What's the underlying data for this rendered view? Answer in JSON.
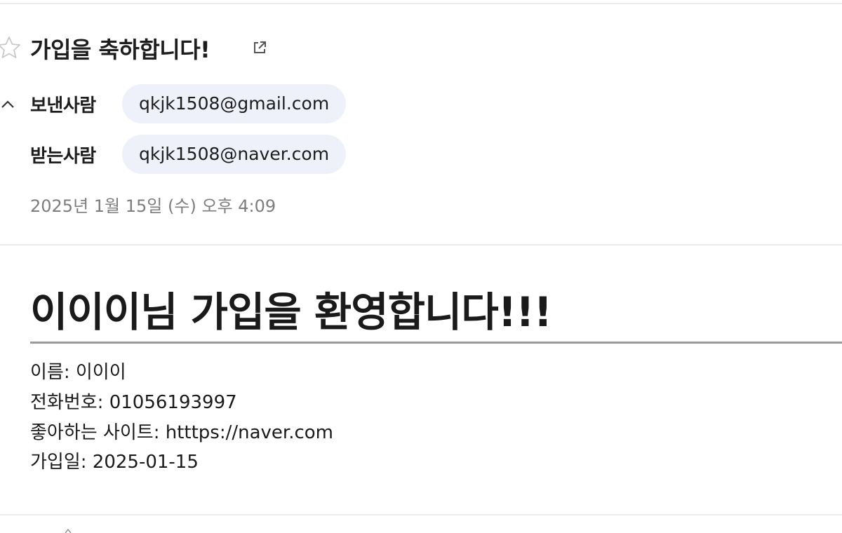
{
  "mail": {
    "subject": "가입을 축하합니다!",
    "sender_label": "보낸사람",
    "sender_email": "qkjk1508@gmail.com",
    "recipient_label": "받는사람",
    "recipient_email": "qkjk1508@naver.com",
    "date": "2025년 1월 15일 (수) 오후 4:09"
  },
  "content": {
    "heading": "이이이님 가입을 환영합니다!!!",
    "lines": [
      "이름: 이이이",
      "전화번호: 01056193997",
      "좋아하는 사이트: htttps://naver.com",
      "가입일: 2025-01-15"
    ]
  },
  "icons": {
    "star": "star-outline-icon",
    "popout": "external-link-icon",
    "collapse": "chevron-up-icon"
  },
  "colors": {
    "chip_background": "#eef1f9",
    "date_text": "#7d7d7d",
    "divider": "#ececec",
    "rule": "#9a9a9a"
  }
}
